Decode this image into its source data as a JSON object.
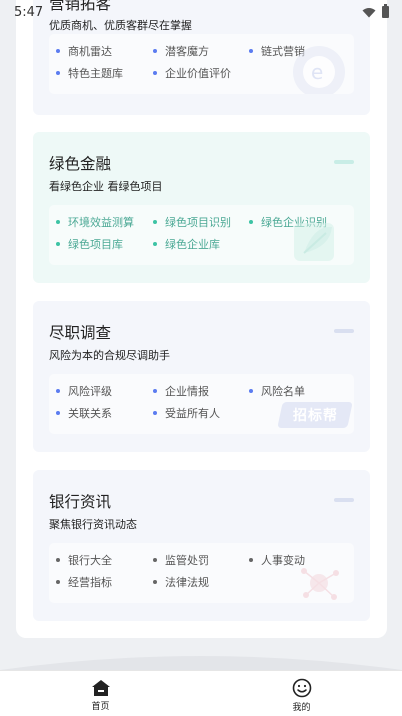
{
  "status_bar": {
    "time": "5:47"
  },
  "top_card": {
    "title": "营销拓客",
    "subtitle": "优质商机、优质客群尽在掌握",
    "tags": [
      "商机雷达",
      "潜客魔方",
      "链式营销",
      "特色主题库",
      "企业价值评价"
    ]
  },
  "green_card": {
    "title": "绿色金融",
    "subtitle": "看绿色企业 看绿色项目",
    "tags": [
      "环境效益测算",
      "绿色项目识别",
      "绿色企业识别",
      "绿色项目库",
      "绿色企业库"
    ]
  },
  "due_card": {
    "title": "尽职调查",
    "subtitle": "风险为本的合规尽调助手",
    "tags": [
      "风险评级",
      "企业情报",
      "风险名单",
      "关联关系",
      "受益所有人"
    ],
    "watermark_text": "招标帮"
  },
  "bank_card": {
    "title": "银行资讯",
    "subtitle": "聚焦银行资讯动态",
    "tags": [
      "银行大全",
      "监管处罚",
      "人事变动",
      "经营指标",
      "法律法规"
    ]
  },
  "bottom_nav": {
    "items": [
      {
        "label": "首页",
        "icon": "home-icon"
      },
      {
        "label": "我的",
        "icon": "smiley-icon"
      }
    ]
  },
  "colors": {
    "blue_accent": "#5b7cf0",
    "green_accent": "#3cc3a4",
    "page_bg": "#eef0f3"
  }
}
